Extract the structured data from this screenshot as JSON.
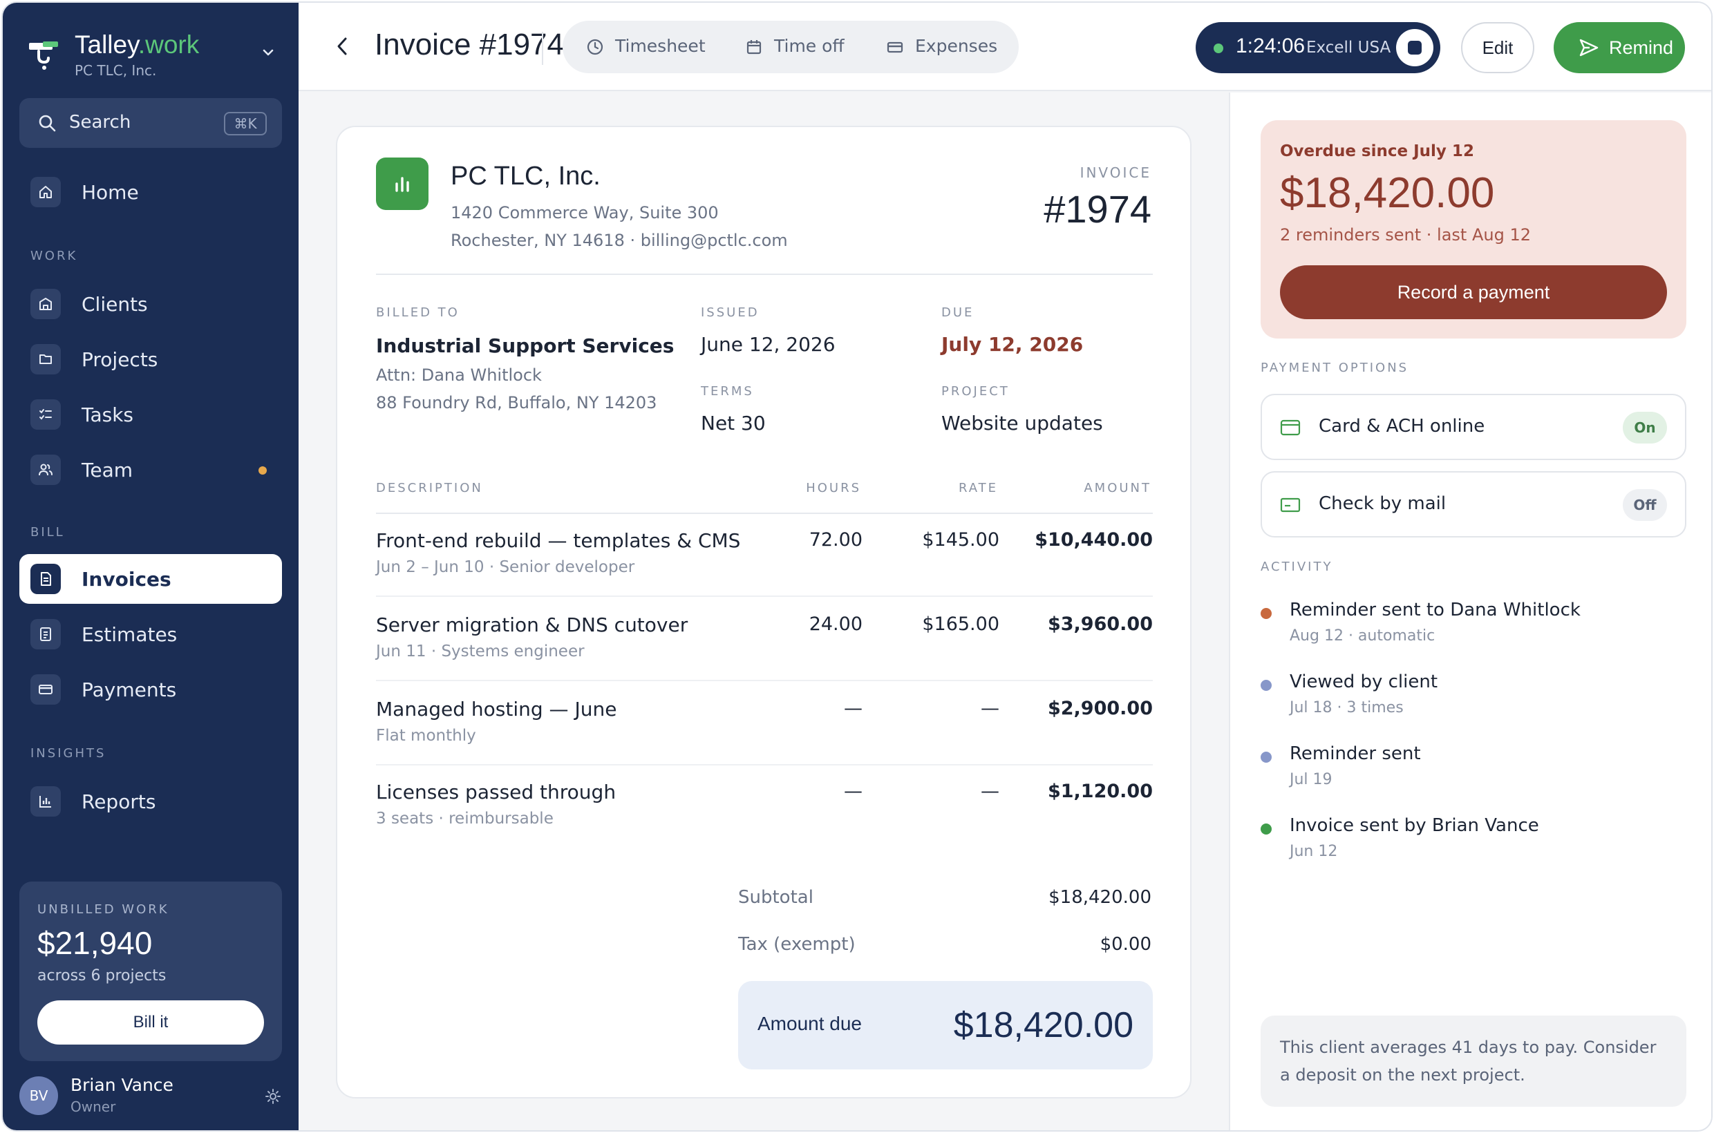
{
  "brand": {
    "name": "Talley",
    "tld": ".work",
    "org": "PC TLC, Inc."
  },
  "search": {
    "label": "Search",
    "shortcut": "⌘K"
  },
  "sidebar": {
    "home": "Home",
    "sections": {
      "work": "WORK",
      "bill": "BILL",
      "insights": "INSIGHTS"
    },
    "items": [
      {
        "label": "Clients",
        "icon": "clients-icon"
      },
      {
        "label": "Projects",
        "icon": "folder-icon"
      },
      {
        "label": "Tasks",
        "icon": "checklist-icon"
      },
      {
        "label": "Team",
        "icon": "team-icon"
      },
      {
        "label": "Invoices",
        "icon": "invoice-icon",
        "active": true
      },
      {
        "label": "Estimates",
        "icon": "estimate-icon"
      },
      {
        "label": "Payments",
        "icon": "card-icon"
      },
      {
        "label": "Reports",
        "icon": "chart-icon"
      }
    ],
    "unbilled": {
      "label": "UNBILLED WORK",
      "amount": "$21,940",
      "sub": "across 6 projects",
      "button": "Bill it"
    },
    "user": {
      "initials": "BV",
      "name": "Brian Vance",
      "role": "Owner"
    }
  },
  "topbar": {
    "title": "Invoice #1974",
    "tabs": [
      {
        "label": "Timesheet",
        "icon": "clock-icon"
      },
      {
        "label": "Time off",
        "icon": "calendar-icon"
      },
      {
        "label": "Expenses",
        "icon": "card-icon"
      }
    ],
    "timer": {
      "time": "1:24:06",
      "client": "Excell USA"
    },
    "edit": "Edit",
    "remind": "Remind"
  },
  "invoice": {
    "company": "PC TLC, Inc.",
    "address1": "1420 Commerce Way, Suite 300",
    "address2": "Rochester, NY 14618 · billing@pctlc.com",
    "label": "INVOICE",
    "number": "#1974",
    "billed_to_label": "BILLED TO",
    "billed_name": "Industrial Support Services",
    "billed_attn": "Attn: Dana Whitlock",
    "billed_addr": "88 Foundry Rd, Buffalo, NY 14203",
    "issued_label": "ISSUED",
    "issued": "June 12, 2026",
    "due_label": "DUE",
    "due": "July 12, 2026",
    "terms_label": "TERMS",
    "terms": "Net 30",
    "project_label": "PROJECT",
    "project": "Website updates",
    "columns": {
      "description": "DESCRIPTION",
      "hours": "HOURS",
      "rate": "RATE",
      "amount": "AMOUNT"
    },
    "lines": [
      {
        "desc": "Front-end rebuild — templates & CMS",
        "sub": "Jun 2 – Jun 10 · Senior developer",
        "hours": "72.00",
        "rate": "$145.00",
        "amount": "$10,440.00"
      },
      {
        "desc": "Server migration & DNS cutover",
        "sub": "Jun 11 · Systems engineer",
        "hours": "24.00",
        "rate": "$165.00",
        "amount": "$3,960.00"
      },
      {
        "desc": "Managed hosting — June",
        "sub": "Flat monthly",
        "hours": "—",
        "rate": "—",
        "amount": "$2,900.00"
      },
      {
        "desc": "Licenses passed through",
        "sub": "3 seats · reimbursable",
        "hours": "—",
        "rate": "—",
        "amount": "$1,120.00"
      }
    ],
    "subtotal_label": "Subtotal",
    "subtotal": "$18,420.00",
    "tax_label": "Tax (exempt)",
    "tax": "$0.00",
    "amount_due_label": "Amount due",
    "amount_due": "$18,420.00"
  },
  "panel": {
    "overdue_title": "Overdue since July 12",
    "overdue_amount": "$18,420.00",
    "overdue_sub": "2 reminders sent · last Aug 12",
    "record_payment": "Record a payment",
    "payment_options_label": "PAYMENT OPTIONS",
    "payment_options": [
      {
        "label": "Card & ACH online",
        "state": "On"
      },
      {
        "label": "Check by mail",
        "state": "Off"
      }
    ],
    "activity_label": "ACTIVITY",
    "activity": [
      {
        "title": "Reminder sent to Dana Whitlock",
        "sub": "Aug 12 · automatic",
        "color": "#c8693e"
      },
      {
        "title": "Viewed by client",
        "sub": "Jul 18 · 3 times",
        "color": "#8797c9"
      },
      {
        "title": "Reminder sent",
        "sub": "Jul 19",
        "color": "#8797c9"
      },
      {
        "title": "Invoice sent by Brian Vance",
        "sub": "Jun 12",
        "color": "#3f9c4a"
      }
    ],
    "hint": "This client averages 41 days to pay. Consider a deposit on the next project."
  },
  "colors": {
    "navy": "#1b2d54",
    "green": "#3f9c4a",
    "overdue": "#8d3b2e"
  }
}
